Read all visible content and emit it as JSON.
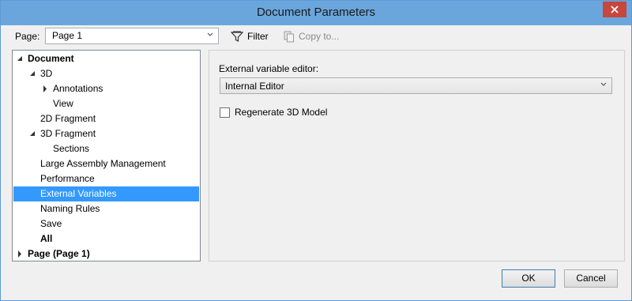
{
  "window": {
    "title": "Document Parameters",
    "close_glyph": "close-icon"
  },
  "toolbar": {
    "page_label": "Page:",
    "page_value": "Page 1",
    "filter_label": "Filter",
    "copy_label": "Copy to..."
  },
  "tree": {
    "items": [
      {
        "label": "Document",
        "expanded": true
      },
      {
        "label": "3D",
        "expanded": true
      },
      {
        "label": "Annotations",
        "expanded": false
      },
      {
        "label": "View"
      },
      {
        "label": "2D Fragment"
      },
      {
        "label": "3D Fragment",
        "expanded": true
      },
      {
        "label": "Sections"
      },
      {
        "label": "Large Assembly Management"
      },
      {
        "label": "Performance"
      },
      {
        "label": "External Variables",
        "selected": true
      },
      {
        "label": "Naming Rules"
      },
      {
        "label": "Save"
      },
      {
        "label": "All"
      },
      {
        "label": "Page (Page 1)",
        "expanded": false
      }
    ]
  },
  "panel": {
    "editor_label": "External variable editor:",
    "editor_value": "Internal Editor",
    "regenerate_label": "Regenerate 3D Model",
    "regenerate_checked": false
  },
  "buttons": {
    "ok": "OK",
    "cancel": "Cancel"
  },
  "colors": {
    "titlebar": "#6aa6dc",
    "selection": "#3399ff",
    "close": "#c7463d"
  }
}
